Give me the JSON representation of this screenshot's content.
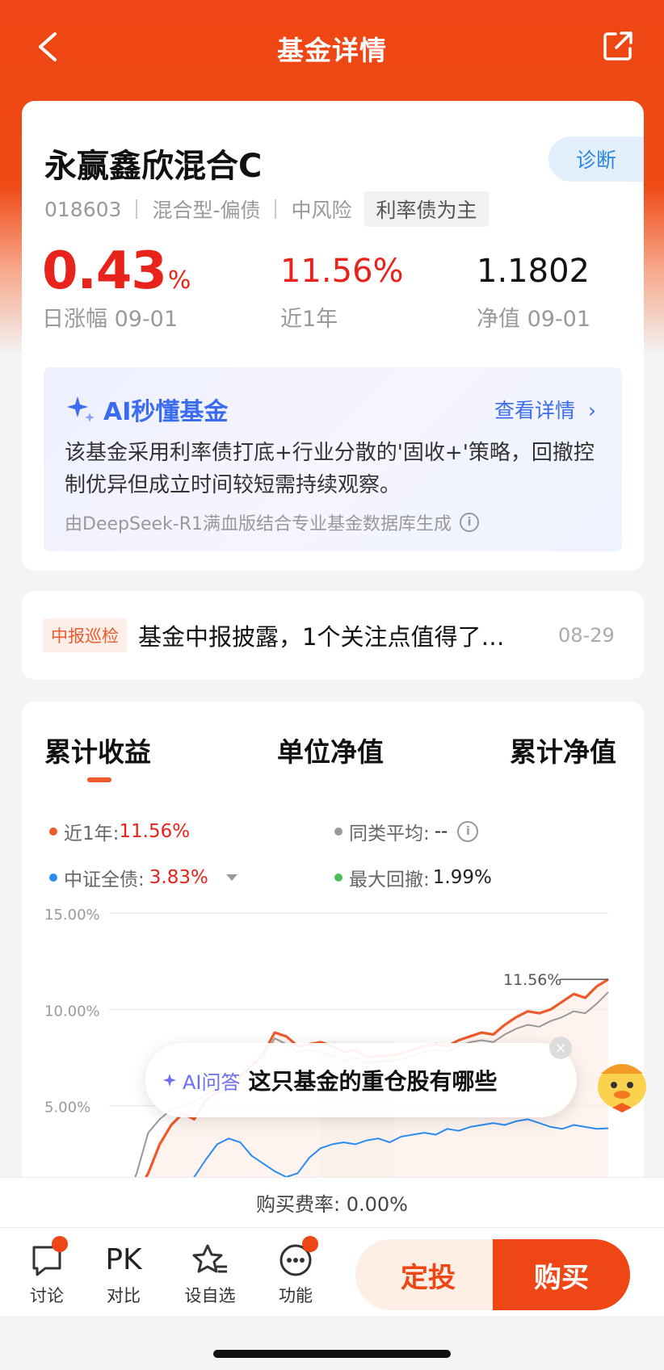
{
  "nav": {
    "title": "基金详情"
  },
  "fund": {
    "name": "永赢鑫欣混合C",
    "diagnose_label": "诊断",
    "code": "018603",
    "type": "混合型-偏债",
    "risk": "中风险",
    "tag": "利率债为主",
    "day_change_value": "0.43",
    "day_change_unit": "%",
    "day_change_label": "日涨幅 09-01",
    "year_change_value": "11.56%",
    "year_change_label": "近1年",
    "nav_value": "1.1802",
    "nav_label": "净值 09-01"
  },
  "ai_summary": {
    "title": "AI秒懂基金",
    "more_label": "查看详情",
    "text": "该基金采用利率债打底+行业分散的'固收+'策略，回撤控制优异但成立时间较短需持续观察。",
    "footer": "由DeepSeek-R1满血版结合专业基金数据库生成"
  },
  "news": {
    "tag": "中报巡检",
    "title": "基金中报披露，1个关注点值得了…",
    "date": "08-29"
  },
  "chart_tabs": [
    "累计收益",
    "单位净值",
    "累计净值"
  ],
  "legend": {
    "item1_label": "近1年:",
    "item1_value": "11.56%",
    "item2_label": "同类平均:",
    "item2_value": "--",
    "item3_label": "中证全债:",
    "item3_value": "3.83%",
    "item4_label": "最大回撤:",
    "item4_value": "1.99%"
  },
  "colors": {
    "fund": "#ee5a2b",
    "peer": "#999999",
    "index": "#2a8cf0",
    "drawdown": "#4cbe5a",
    "accent": "#ee4614"
  },
  "chart_data": {
    "type": "line",
    "ylim": [
      0,
      15
    ],
    "yticks": [
      "15.00%",
      "10.00%",
      "5.00%"
    ],
    "end_label": "11.56%",
    "series": [
      {
        "name": "近1年",
        "values": [
          0.0,
          0.4,
          1.5,
          3.0,
          4.0,
          4.6,
          4.3,
          5.3,
          5.7,
          5.8,
          6.5,
          7.1,
          7.7,
          8.8,
          8.6,
          8.1,
          8.2,
          8.3,
          8.1,
          7.8,
          7.9,
          7.5,
          7.6,
          7.6,
          7.7,
          7.9,
          8.1,
          8.2,
          8.1,
          8.4,
          8.6,
          8.8,
          8.7,
          9.2,
          9.6,
          9.9,
          9.8,
          10.0,
          10.4,
          10.8,
          10.6,
          11.2,
          11.56
        ]
      },
      {
        "name": "同类平均",
        "values": [
          0.0,
          1.5,
          3.6,
          4.3,
          4.8,
          5.0,
          5.2,
          5.6,
          5.9,
          6.0,
          6.6,
          7.1,
          7.5,
          8.5,
          8.2,
          7.8,
          7.9,
          7.8,
          7.6,
          7.3,
          7.5,
          7.2,
          7.3,
          7.3,
          7.4,
          7.6,
          7.8,
          7.9,
          7.8,
          8.1,
          8.3,
          8.4,
          8.3,
          8.7,
          9.0,
          9.2,
          9.1,
          9.4,
          9.6,
          9.9,
          9.8,
          10.3,
          10.9
        ]
      },
      {
        "name": "中证全债",
        "values": [
          0.0,
          0.2,
          0.4,
          0.3,
          0.1,
          0.5,
          1.3,
          2.2,
          3.0,
          3.3,
          3.1,
          2.4,
          2.0,
          1.6,
          1.3,
          1.5,
          2.3,
          2.8,
          3.0,
          3.1,
          3.0,
          3.2,
          3.3,
          3.1,
          3.4,
          3.5,
          3.6,
          3.5,
          3.8,
          3.7,
          3.9,
          4.0,
          4.1,
          4.0,
          4.2,
          4.3,
          4.1,
          3.9,
          3.8,
          4.0,
          3.9,
          3.8,
          3.83
        ]
      }
    ]
  },
  "ai_float": {
    "tag": "AI问答",
    "question": "这只基金的重仓股有哪些"
  },
  "fee": {
    "text": "购买费率: 0.00%"
  },
  "bottom": {
    "discuss": "讨论",
    "pk_icon": "PK",
    "compare": "对比",
    "watch": "设自选",
    "func": "功能",
    "dingtou": "定投",
    "buy": "购买"
  }
}
